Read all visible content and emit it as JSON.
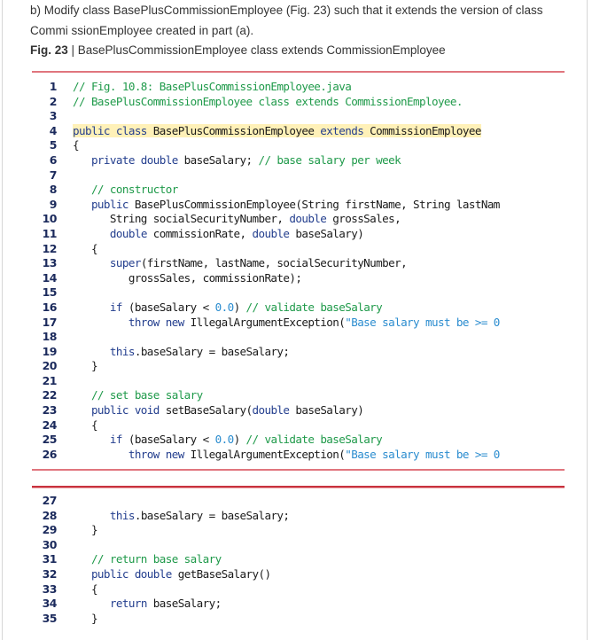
{
  "intro": {
    "text": "b) Modify class BasePlusCommissionEmployee (Fig. 23) such that it extends the version of class Commi ssionEmployee created in part (a)."
  },
  "caption": {
    "label": "Fig. 23",
    "separator": " | ",
    "text": "BasePlusCommissionEmployee class extends CommissionEmployee"
  },
  "code_block_1": {
    "lines": [
      {
        "n": "1",
        "tokens": [
          {
            "t": "// Fig. 10.8: BasePlusCommissionEmployee.java",
            "c": "cm"
          }
        ]
      },
      {
        "n": "2",
        "tokens": [
          {
            "t": "// BasePlusCommissionEmployee class extends CommissionEmployee.",
            "c": "cm"
          }
        ]
      },
      {
        "n": "3",
        "tokens": []
      },
      {
        "n": "4",
        "highlight": true,
        "tokens": [
          {
            "t": "public class",
            "c": "kw"
          },
          {
            "t": " BasePlusCommissionEmployee ",
            "c": ""
          },
          {
            "t": "extends",
            "c": "kw"
          },
          {
            "t": " CommissionEmployee",
            "c": ""
          }
        ]
      },
      {
        "n": "5",
        "tokens": [
          {
            "t": "{",
            "c": ""
          }
        ]
      },
      {
        "n": "6",
        "tokens": [
          {
            "t": "   ",
            "c": ""
          },
          {
            "t": "private double",
            "c": "kw"
          },
          {
            "t": " baseSalary; ",
            "c": ""
          },
          {
            "t": "// base salary per week",
            "c": "cm"
          }
        ]
      },
      {
        "n": "7",
        "tokens": []
      },
      {
        "n": "8",
        "tokens": [
          {
            "t": "   ",
            "c": ""
          },
          {
            "t": "// constructor",
            "c": "cm"
          }
        ]
      },
      {
        "n": "9",
        "tokens": [
          {
            "t": "   ",
            "c": ""
          },
          {
            "t": "public",
            "c": "kw"
          },
          {
            "t": " BasePlusCommissionEmployee(String firstName, String lastNam",
            "c": ""
          }
        ]
      },
      {
        "n": "10",
        "tokens": [
          {
            "t": "      String socialSecurityNumber, ",
            "c": ""
          },
          {
            "t": "double",
            "c": "kw"
          },
          {
            "t": " grossSales,",
            "c": ""
          }
        ]
      },
      {
        "n": "11",
        "tokens": [
          {
            "t": "      ",
            "c": ""
          },
          {
            "t": "double",
            "c": "kw"
          },
          {
            "t": " commissionRate, ",
            "c": ""
          },
          {
            "t": "double",
            "c": "kw"
          },
          {
            "t": " baseSalary)",
            "c": ""
          }
        ]
      },
      {
        "n": "12",
        "tokens": [
          {
            "t": "   {",
            "c": ""
          }
        ]
      },
      {
        "n": "13",
        "tokens": [
          {
            "t": "      ",
            "c": ""
          },
          {
            "t": "super",
            "c": "kw"
          },
          {
            "t": "(firstName, lastName, socialSecurityNumber,",
            "c": ""
          }
        ]
      },
      {
        "n": "14",
        "tokens": [
          {
            "t": "         grossSales, commissionRate);",
            "c": ""
          }
        ]
      },
      {
        "n": "15",
        "tokens": []
      },
      {
        "n": "16",
        "tokens": [
          {
            "t": "      ",
            "c": ""
          },
          {
            "t": "if",
            "c": "kw"
          },
          {
            "t": " (baseSalary < ",
            "c": ""
          },
          {
            "t": "0.0",
            "c": "lit"
          },
          {
            "t": ") ",
            "c": ""
          },
          {
            "t": "// validate baseSalary",
            "c": "cm"
          }
        ]
      },
      {
        "n": "17",
        "tokens": [
          {
            "t": "         ",
            "c": ""
          },
          {
            "t": "throw new",
            "c": "kw"
          },
          {
            "t": " IllegalArgumentException(",
            "c": ""
          },
          {
            "t": "\"Base salary must be >= 0",
            "c": "lit"
          }
        ]
      },
      {
        "n": "18",
        "tokens": []
      },
      {
        "n": "19",
        "tokens": [
          {
            "t": "      ",
            "c": ""
          },
          {
            "t": "this",
            "c": "kw"
          },
          {
            "t": ".baseSalary = baseSalary;",
            "c": ""
          }
        ]
      },
      {
        "n": "20",
        "tokens": [
          {
            "t": "   }",
            "c": ""
          }
        ]
      },
      {
        "n": "21",
        "tokens": []
      },
      {
        "n": "22",
        "tokens": [
          {
            "t": "   ",
            "c": ""
          },
          {
            "t": "// set base salary",
            "c": "cm"
          }
        ]
      },
      {
        "n": "23",
        "tokens": [
          {
            "t": "   ",
            "c": ""
          },
          {
            "t": "public void",
            "c": "kw"
          },
          {
            "t": " setBaseSalary(",
            "c": ""
          },
          {
            "t": "double",
            "c": "kw"
          },
          {
            "t": " baseSalary)",
            "c": ""
          }
        ]
      },
      {
        "n": "24",
        "tokens": [
          {
            "t": "   {",
            "c": ""
          }
        ]
      },
      {
        "n": "25",
        "tokens": [
          {
            "t": "      ",
            "c": ""
          },
          {
            "t": "if",
            "c": "kw"
          },
          {
            "t": " (baseSalary < ",
            "c": ""
          },
          {
            "t": "0.0",
            "c": "lit"
          },
          {
            "t": ") ",
            "c": ""
          },
          {
            "t": "// validate baseSalary",
            "c": "cm"
          }
        ]
      },
      {
        "n": "26",
        "tokens": [
          {
            "t": "         ",
            "c": ""
          },
          {
            "t": "throw new",
            "c": "kw"
          },
          {
            "t": " IllegalArgumentException(",
            "c": ""
          },
          {
            "t": "\"Base salary must be >= 0",
            "c": "lit"
          }
        ]
      }
    ]
  },
  "code_block_2": {
    "lines": [
      {
        "n": "27",
        "tokens": []
      },
      {
        "n": "28",
        "tokens": [
          {
            "t": "      ",
            "c": ""
          },
          {
            "t": "this",
            "c": "kw"
          },
          {
            "t": ".baseSalary = baseSalary;",
            "c": ""
          }
        ]
      },
      {
        "n": "29",
        "tokens": [
          {
            "t": "   }",
            "c": ""
          }
        ]
      },
      {
        "n": "30",
        "tokens": []
      },
      {
        "n": "31",
        "tokens": [
          {
            "t": "   ",
            "c": ""
          },
          {
            "t": "// return base salary",
            "c": "cm"
          }
        ]
      },
      {
        "n": "32",
        "tokens": [
          {
            "t": "   ",
            "c": ""
          },
          {
            "t": "public double",
            "c": "kw"
          },
          {
            "t": " getBaseSalary()",
            "c": ""
          }
        ]
      },
      {
        "n": "33",
        "tokens": [
          {
            "t": "   {",
            "c": ""
          }
        ]
      },
      {
        "n": "34",
        "tokens": [
          {
            "t": "      ",
            "c": ""
          },
          {
            "t": "return",
            "c": "kw"
          },
          {
            "t": " baseSalary;",
            "c": ""
          }
        ]
      },
      {
        "n": "35",
        "tokens": [
          {
            "t": "   }",
            "c": ""
          }
        ]
      }
    ]
  },
  "colors": {
    "keyword": "#233e8e",
    "comment": "#1f9a4a",
    "literal": "#2a8ccf",
    "line_number": "#1b2a5c",
    "highlight": "#fff1b8",
    "rule": "#c8323e"
  }
}
